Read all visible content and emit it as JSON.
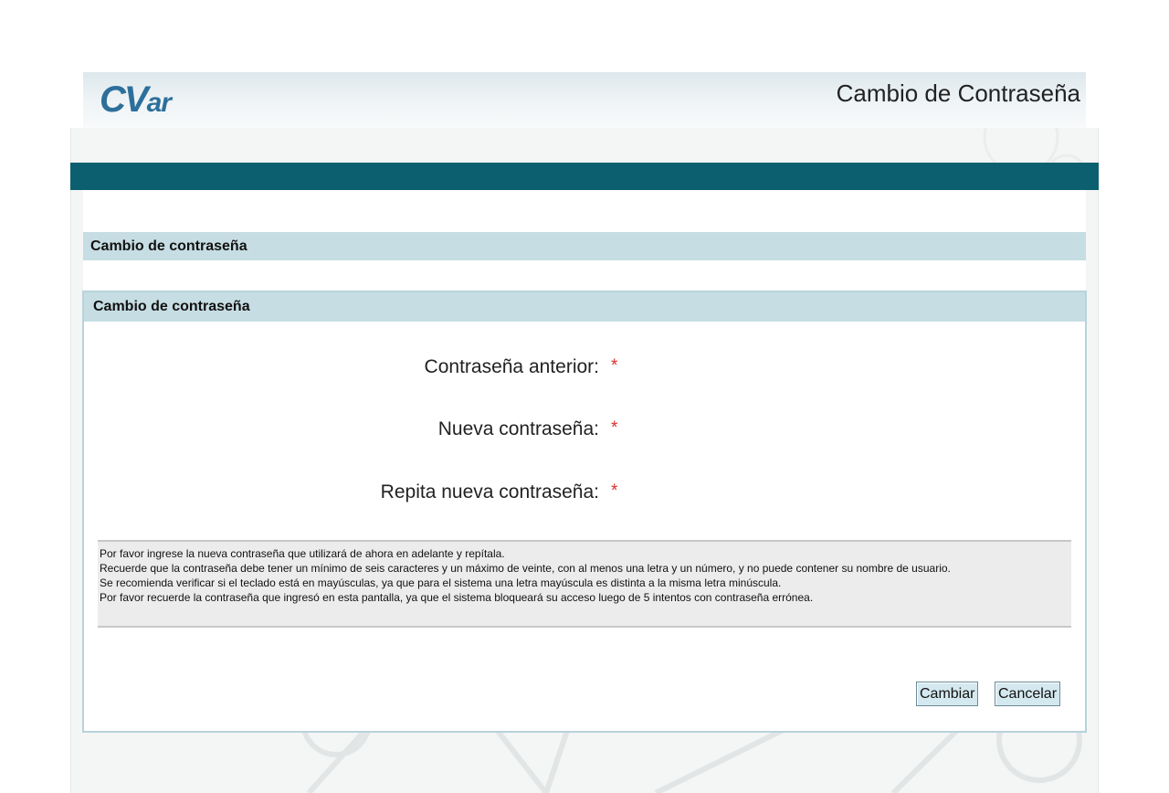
{
  "header": {
    "logo_main": "CV",
    "logo_sub": "ar",
    "title": "Cambio de Contraseña"
  },
  "section": {
    "title": "Cambio de contraseña"
  },
  "form": {
    "title": "Cambio de contraseña",
    "fields": [
      {
        "label": "Contraseña anterior:",
        "required_mark": "*"
      },
      {
        "label": "Nueva contraseña:",
        "required_mark": "*"
      },
      {
        "label": "Repita nueva contraseña:",
        "required_mark": "*"
      }
    ],
    "info": [
      "Por favor ingrese la nueva contraseña que utilizará de ahora en adelante y repítala.",
      "Recuerde que la contraseña debe tener un mínimo de seis caracteres y un máximo de veinte, con al menos una letra y un número, y no puede contener su nombre de usuario.",
      "Se recomienda verificar si el teclado está en mayúsculas, ya que para el sistema una letra mayúscula es distinta a la misma letra minúscula.",
      "Por favor recuerde la contraseña que ingresó en esta pantalla, ya que el sistema bloqueará su acceso luego de 5 intentos con contraseña errónea."
    ],
    "buttons": {
      "submit": "Cambiar",
      "cancel": "Cancelar"
    }
  },
  "colors": {
    "accent_band": "#0b5f6f",
    "section_bar": "#c6dde3",
    "logo": "#2d6f9b",
    "required": "#d9302c"
  }
}
